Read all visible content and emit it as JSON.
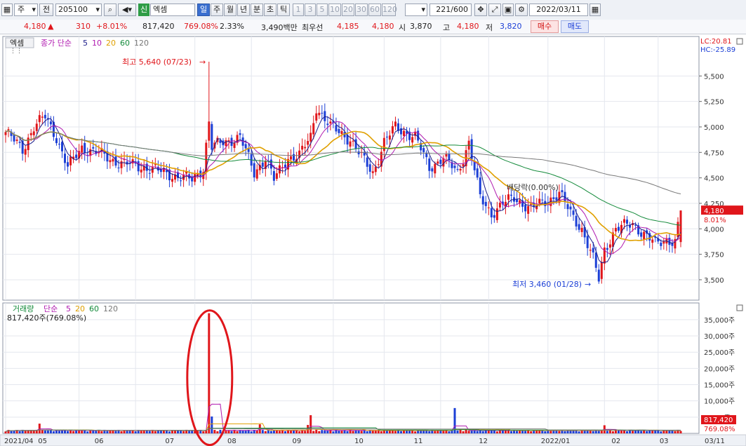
{
  "toolbar": {
    "period_select": "주",
    "prev_label": "전",
    "code": "205100",
    "badge": "신",
    "name": "엑셈",
    "periods": [
      "일",
      "주",
      "월",
      "년",
      "분",
      "초",
      "틱"
    ],
    "active_period": "일",
    "intervals": [
      "1",
      "3",
      "5",
      "10",
      "20",
      "30",
      "60",
      "120"
    ],
    "count": "221",
    "count_total": "/600",
    "date": "2022/03/11"
  },
  "quote": {
    "price": "4,180",
    "arrow": "▲",
    "change": "310",
    "change_pct": "+8.01%",
    "volume": "817,420",
    "volume_ratio": "769.08%",
    "turnover": "2.33%",
    "amount": "3,490백만",
    "best_ask_label": "최우선",
    "best_ask": "4,185",
    "best_bid": "4,180",
    "open_label": "시",
    "open": "3,870",
    "high_label": "고",
    "high": "4,180",
    "low_label": "저",
    "low": "3,820",
    "buy_label": "매수",
    "sell_label": "매도"
  },
  "colors": {
    "up": "#e0161b",
    "down": "#1c3fd6",
    "ma5": "#1c1c8a",
    "ma10": "#b01ab0",
    "ma20": "#e0a000",
    "ma60": "#138a3a",
    "ma120": "#777777"
  },
  "chart_data": [
    {
      "type": "candlestick",
      "title_tag": "엑셈",
      "legend": {
        "label": "종가 단순",
        "periods": [
          "5",
          "10",
          "20",
          "60",
          "120"
        ]
      },
      "annotations": {
        "high": "최고 5,640 (07/23)",
        "low": "최저 3,460 (01/28)",
        "dividend": "배당락(0.00%)"
      },
      "right_labels": {
        "lc": "LC:20.81",
        "hc": "HC:-25.89",
        "last": "4,180",
        "last_pct": "8.01%"
      },
      "ylim": [
        3300,
        5750
      ],
      "yticks": [
        3500,
        3750,
        4000,
        4250,
        4500,
        4750,
        5000,
        5250,
        5500
      ],
      "ytick_labels": [
        "3,500",
        "3,750",
        "4,000",
        "4,250",
        "4,500",
        "4,750",
        "5,000",
        "5,250",
        "5,500"
      ],
      "x_labels": [
        "2021/04",
        "05",
        "06",
        "07",
        "08",
        "09",
        "10",
        "11",
        "12",
        "2022/01",
        "02",
        "03",
        "03/11"
      ],
      "close_anchors": [
        [
          0,
          4950
        ],
        [
          6,
          4780
        ],
        [
          10,
          5000
        ],
        [
          14,
          5100
        ],
        [
          18,
          4900
        ],
        [
          22,
          4600
        ],
        [
          27,
          4800
        ],
        [
          32,
          4750
        ],
        [
          40,
          4650
        ],
        [
          50,
          4600
        ],
        [
          60,
          4520
        ],
        [
          66,
          4480
        ],
        [
          70,
          4600
        ],
        [
          72,
          5050
        ],
        [
          73,
          4800
        ],
        [
          77,
          4850
        ],
        [
          83,
          4900
        ],
        [
          88,
          4550
        ],
        [
          92,
          4700
        ],
        [
          95,
          4480
        ],
        [
          100,
          4700
        ],
        [
          104,
          4720
        ],
        [
          108,
          4900
        ],
        [
          110,
          5200
        ],
        [
          115,
          5000
        ],
        [
          122,
          4880
        ],
        [
          126,
          4700
        ],
        [
          130,
          4550
        ],
        [
          134,
          4850
        ],
        [
          138,
          5000
        ],
        [
          145,
          4900
        ],
        [
          150,
          4600
        ],
        [
          155,
          4700
        ],
        [
          160,
          4550
        ],
        [
          164,
          4850
        ],
        [
          168,
          4300
        ],
        [
          172,
          4150
        ],
        [
          176,
          4250
        ],
        [
          180,
          4300
        ],
        [
          186,
          4200
        ],
        [
          192,
          4280
        ],
        [
          196,
          4350
        ],
        [
          200,
          4150
        ],
        [
          204,
          4000
        ],
        [
          208,
          3700
        ],
        [
          210,
          3500
        ],
        [
          212,
          3800
        ],
        [
          216,
          4000
        ],
        [
          222,
          4050
        ],
        [
          226,
          3950
        ],
        [
          230,
          3850
        ],
        [
          234,
          3900
        ],
        [
          237,
          3870
        ],
        [
          239,
          4180
        ]
      ],
      "ma_values": {
        "ma20_start": 4820,
        "ma60_start": 4740,
        "ma120_start": 4380,
        "ma120_end": 4380
      }
    },
    {
      "type": "bar",
      "title": "거래량",
      "legend": {
        "label": "단순",
        "periods": [
          "5",
          "20",
          "60",
          "120"
        ]
      },
      "current_label": "817,420주(769.08%)",
      "last_value_label": "817,420",
      "last_pct_label": "769.08%",
      "ylim": [
        0,
        38000
      ],
      "yticks": [
        5000,
        10000,
        15000,
        20000,
        25000,
        30000,
        35000
      ],
      "ytick_labels": [
        "5,000주",
        "10,000주",
        "15,000주",
        "20,000주",
        "25,000주",
        "30,000주",
        "35,000주"
      ],
      "spikes": [
        [
          72,
          37000
        ],
        [
          73,
          5200
        ],
        [
          108,
          5600
        ],
        [
          107,
          2600
        ],
        [
          159,
          7800
        ],
        [
          90,
          2800
        ],
        [
          12,
          3000
        ],
        [
          212,
          2500
        ]
      ],
      "baseline": 600
    }
  ]
}
